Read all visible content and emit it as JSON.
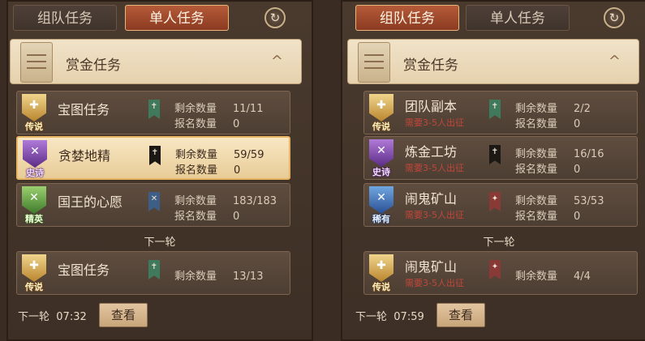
{
  "left": {
    "tabs": [
      "组队任务",
      "单人任务"
    ],
    "active_tab": 1,
    "header_title": "赏金任务",
    "collapse_icon": "^",
    "rows": [
      {
        "badge": "传说",
        "name": "宝图任务",
        "remaining_label": "剩余数量",
        "remaining": "11/11",
        "signup_label": "报名数量",
        "signup": "0"
      },
      {
        "badge": "史诗",
        "name": "贪婪地精",
        "remaining_label": "剩余数量",
        "remaining": "59/59",
        "signup_label": "报名数量",
        "signup": "0"
      },
      {
        "badge": "精英",
        "name": "国王的心愿",
        "remaining_label": "剩余数量",
        "remaining": "183/183",
        "signup_label": "报名数量",
        "signup": "0"
      }
    ],
    "next_round_divider": "下一轮",
    "next_rows": [
      {
        "badge": "传说",
        "name": "宝图任务",
        "remaining_label": "剩余数量",
        "remaining": "13/13"
      }
    ],
    "footer": {
      "label": "下一轮",
      "time": "07:32",
      "button": "查看"
    }
  },
  "right": {
    "tabs": [
      "组队任务",
      "单人任务"
    ],
    "active_tab": 0,
    "header_title": "赏金任务",
    "collapse_icon": "^",
    "rows": [
      {
        "badge": "传说",
        "name": "团队副本",
        "requirement": "需要3-5人出征",
        "remaining_label": "剩余数量",
        "remaining": "2/2",
        "signup_label": "报名数量",
        "signup": "0"
      },
      {
        "badge": "史诗",
        "name": "炼金工坊",
        "requirement": "需要3-5人出征",
        "remaining_label": "剩余数量",
        "remaining": "16/16",
        "signup_label": "报名数量",
        "signup": "0"
      },
      {
        "badge": "稀有",
        "name": "闹鬼矿山",
        "requirement": "需要3-5人出征",
        "remaining_label": "剩余数量",
        "remaining": "53/53",
        "signup_label": "报名数量",
        "signup": "0"
      }
    ],
    "next_round_divider": "下一轮",
    "next_rows": [
      {
        "badge": "传说",
        "name": "闹鬼矿山",
        "requirement": "需要3-5人出征",
        "remaining_label": "剩余数量",
        "remaining": "4/4"
      }
    ],
    "footer": {
      "label": "下一轮",
      "time": "07:59",
      "button": "查看"
    }
  }
}
